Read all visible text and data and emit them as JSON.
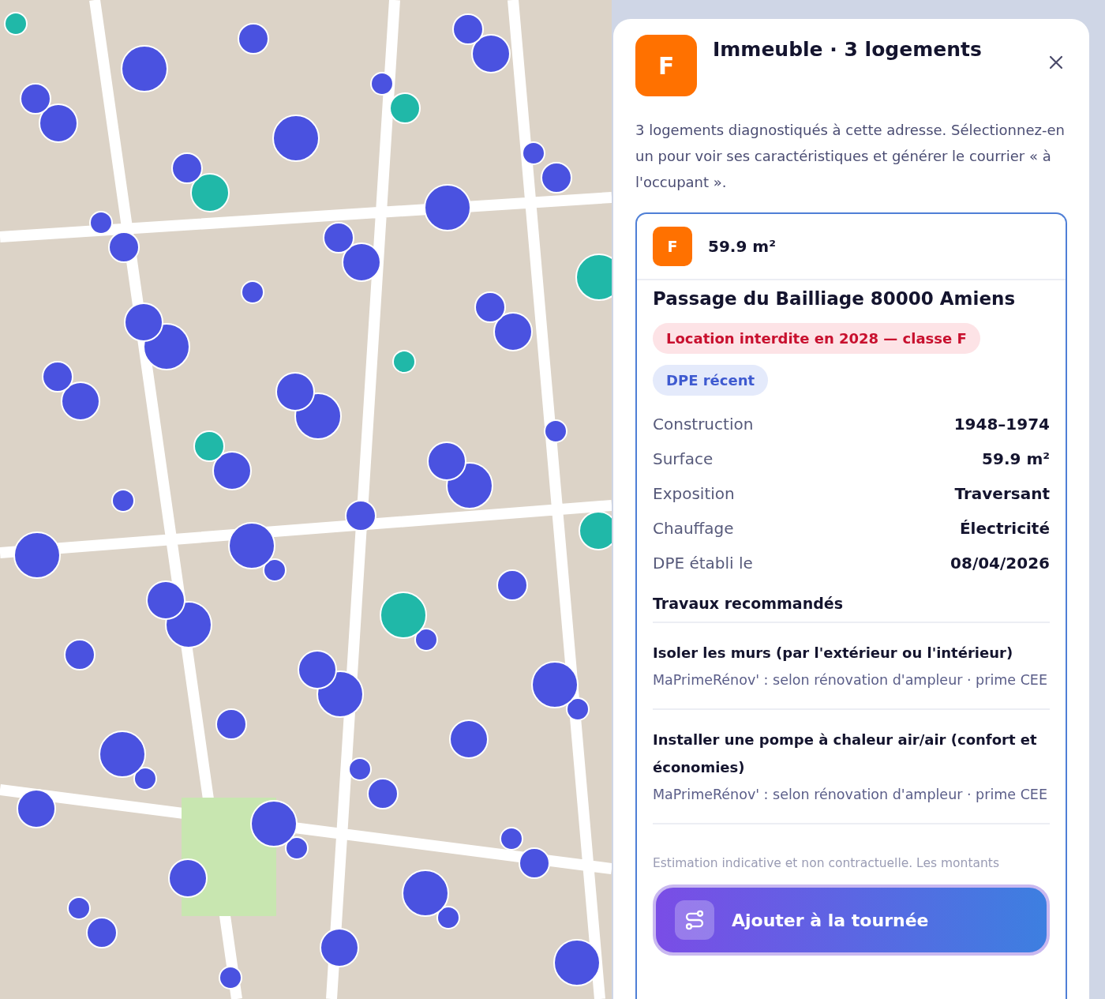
{
  "header": {
    "grade": "F",
    "title": "Immeuble · 3 logements",
    "intro": "3 logements diagnostiqués à cette adresse. Sélectionnez-en un pour voir ses caractéristiques et générer le courrier « à l'occupant »."
  },
  "unit": {
    "grade": "F",
    "area": "59.9 m²",
    "selected": true,
    "address": "Passage du Bailliage 80000 Amiens",
    "badges": [
      {
        "kind": "alert",
        "label": "Location interdite en 2028 — classe F"
      },
      {
        "kind": "info",
        "label": "DPE récent"
      }
    ],
    "details": [
      {
        "label": "Construction",
        "value": "1948–1974"
      },
      {
        "label": "Surface",
        "value": "59.9 m²"
      },
      {
        "label": "Exposition",
        "value": "Traversant"
      },
      {
        "label": "Chauffage",
        "value": "Électricité"
      },
      {
        "label": "DPE établi le",
        "value": "08/04/2026"
      }
    ],
    "works_title": "Travaux recommandés",
    "works": [
      {
        "title": "Isoler les murs (par l'extérieur ou l'intérieur)",
        "aid": "MaPrimeRénov' : selon rénovation d'ampleur · prime CEE"
      },
      {
        "title": "Installer une pompe à chaleur air/air (confort et économies)",
        "aid": "MaPrimeRénov' : selon rénovation d'ampleur · prime CEE"
      }
    ],
    "disclaimer": "Estimation indicative et non contractuelle. Les montants"
  },
  "action": {
    "label": "Ajouter à la tournée"
  }
}
